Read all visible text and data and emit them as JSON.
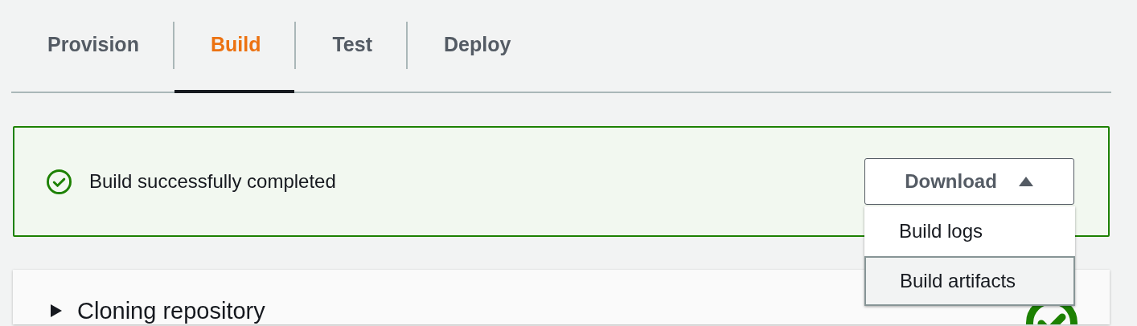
{
  "tabs": [
    {
      "label": "Provision",
      "selected": false
    },
    {
      "label": "Build",
      "selected": true
    },
    {
      "label": "Test",
      "selected": false
    },
    {
      "label": "Deploy",
      "selected": false
    }
  ],
  "alert": {
    "kind": "success",
    "message": "Build successfully completed",
    "download": {
      "label": "Download",
      "expanded": true,
      "items": [
        {
          "label": "Build logs",
          "selected": false
        },
        {
          "label": "Build artifacts",
          "selected": true
        }
      ]
    }
  },
  "steps": [
    {
      "title": "Cloning repository",
      "expanded": false,
      "done": true
    }
  ]
}
